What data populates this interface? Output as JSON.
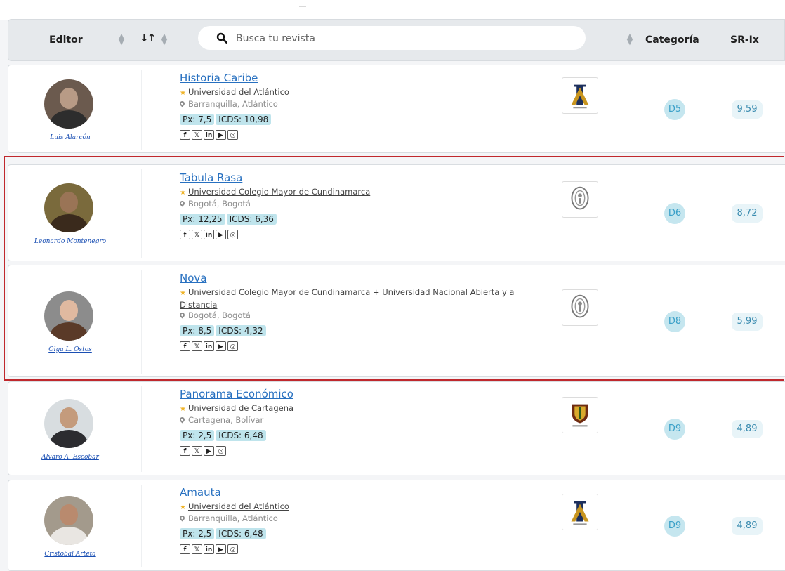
{
  "header": {
    "editor_label": "Editor",
    "sort_label": "↓↑",
    "search_placeholder": "Busca tu revista",
    "category_label": "Categoría",
    "srix_label": "SR-Ix"
  },
  "rows": [
    {
      "editor": "Luis Alarcón",
      "title": "Historia Caribe",
      "institution": "Universidad del Atlántico",
      "location": "Barranquilla, Atlántico",
      "px": "Px: 7,5",
      "icds": "ICDS: 10,98",
      "social": [
        "f",
        "X",
        "in",
        "▶",
        "◎"
      ],
      "category": "D5",
      "srix": "9,59",
      "logo": "atlantico",
      "avatar_colors": [
        "#6b5a4e",
        "#2d2d2d",
        "#b89b86"
      ]
    },
    {
      "editor": "Leonardo Montenegro",
      "title": "Tabula Rasa",
      "institution": "Universidad Colegio Mayor de Cundinamarca",
      "location": "Bogotá, Bogotá",
      "px": "Px: 12,25",
      "icds": "ICDS: 6,36",
      "social": [
        "f",
        "X",
        "in",
        "▶",
        "◎"
      ],
      "category": "D6",
      "srix": "8,72",
      "logo": "cundinamarca",
      "avatar_colors": [
        "#7a6a3c",
        "#3a2a1c",
        "#9a7456"
      ]
    },
    {
      "editor": "Olga L. Ostos",
      "title": "Nova",
      "institution": "Universidad Colegio Mayor de Cundinamarca + Universidad Nacional Abierta y a Distancia",
      "location": "Bogotá, Bogotá",
      "px": "Px: 8,5",
      "icds": "ICDS: 4,32",
      "social": [
        "f",
        "X",
        "in",
        "▶",
        "◎"
      ],
      "category": "D8",
      "srix": "5,99",
      "logo": "cundinamarca",
      "avatar_colors": [
        "#8c8c8c",
        "#5a3a28",
        "#e0b9a0"
      ]
    },
    {
      "editor": "Alvaro A. Escobar",
      "title": "Panorama Económico",
      "institution": "Universidad de Cartagena",
      "location": "Cartagena, Bolívar",
      "px": "Px: 2,5",
      "icds": "ICDS: 6,48",
      "social": [
        "f",
        "X",
        "▶",
        "◎"
      ],
      "category": "D9",
      "srix": "4,89",
      "logo": "cartagena",
      "avatar_colors": [
        "#d8dde0",
        "#2c2c30",
        "#c49b7c"
      ]
    },
    {
      "editor": "Cristobal Arteta",
      "title": "Amauta",
      "institution": "Universidad del Atlántico",
      "location": "Barranquilla, Atlántico",
      "px": "Px: 2,5",
      "icds": "ICDS: 6,48",
      "social": [
        "f",
        "X",
        "in",
        "▶",
        "◎"
      ],
      "category": "D9",
      "srix": "4,89",
      "logo": "atlantico",
      "avatar_colors": [
        "#a39a8c",
        "#e9e6e2",
        "#b98a6e"
      ]
    }
  ]
}
